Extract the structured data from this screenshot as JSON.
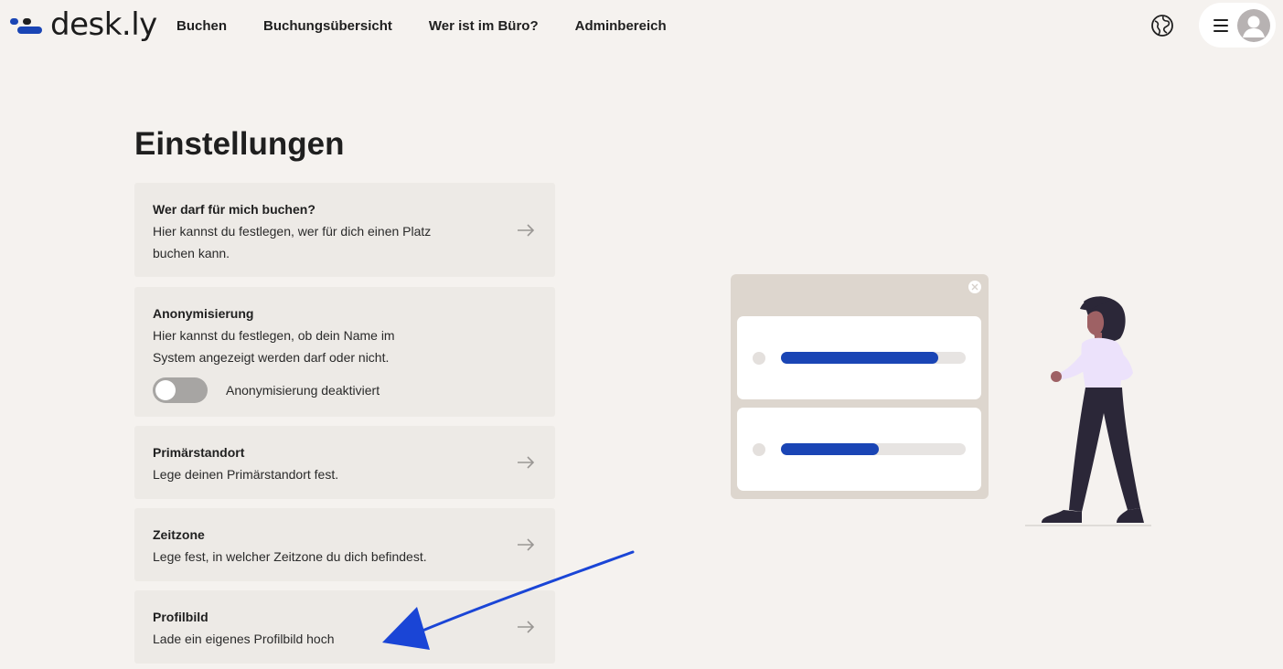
{
  "brand": {
    "name": "desk.ly",
    "colors": {
      "primary": "#1a45b5",
      "dark": "#1f1f1f",
      "background": "#f5f2ef"
    }
  },
  "nav": {
    "items": [
      {
        "label": "Buchen"
      },
      {
        "label": "Buchungsübersicht"
      },
      {
        "label": "Wer ist im Büro?"
      },
      {
        "label": "Adminbereich"
      }
    ]
  },
  "header": {
    "language_icon": "globe-icon",
    "menu_icon": "hamburger-icon",
    "avatar_icon": "user-avatar-icon"
  },
  "page": {
    "title": "Einstellungen"
  },
  "settings": {
    "booking_permission": {
      "title": "Wer darf für mich buchen?",
      "desc_line1": "Hier kannst du festlegen, wer für dich einen Platz",
      "desc_line2": "buchen kann."
    },
    "anonymization": {
      "title": "Anonymisierung",
      "desc_line1": "Hier kannst du festlegen, ob dein Name im",
      "desc_line2": "System angezeigt werden darf oder nicht.",
      "toggle_label": "Anonymisierung deaktiviert",
      "toggle_on": false
    },
    "primary_location": {
      "title": "Primärstandort",
      "desc": "Lege deinen Primärstandort fest."
    },
    "timezone": {
      "title": "Zeitzone",
      "desc": "Lege fest, in welcher Zeitzone du dich befindest."
    },
    "profile_picture": {
      "title": "Profilbild",
      "desc": "Lade ein eigenes Profilbild hoch"
    }
  },
  "illustration": {
    "progress_bars": [
      {
        "fraction": 0.85
      },
      {
        "fraction": 0.53
      }
    ]
  }
}
